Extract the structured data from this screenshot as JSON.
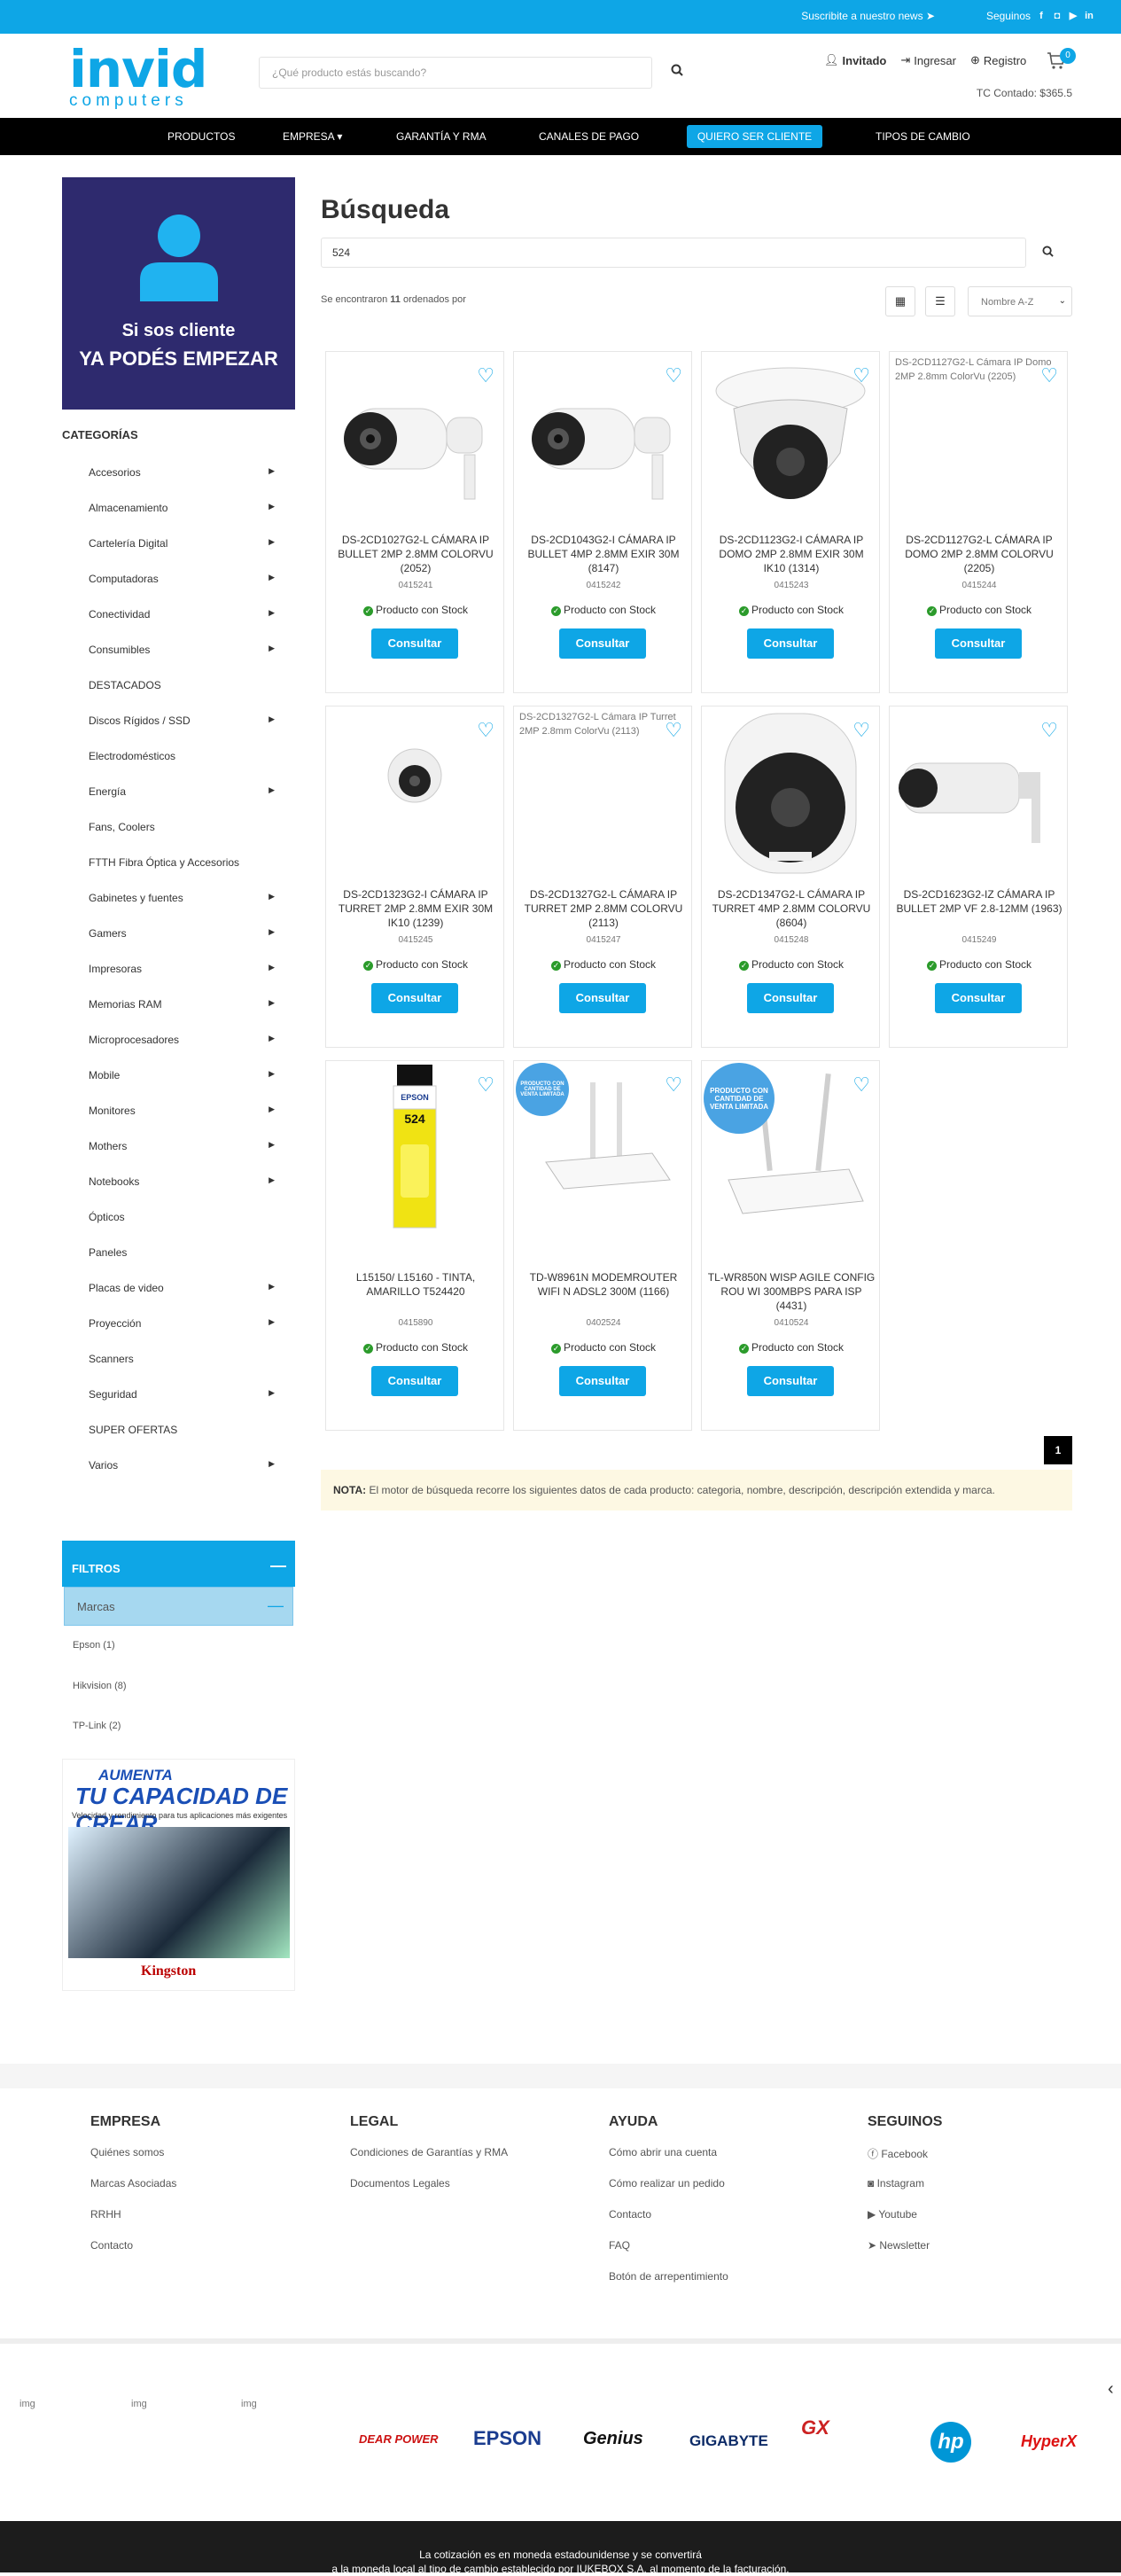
{
  "topbar": {
    "newsletter": "Suscribite a nuestro news",
    "follow": "Seguinos"
  },
  "header": {
    "logo_word": "invid",
    "logo_sub": "computers",
    "search_placeholder": "¿Qué producto estás buscando?",
    "user": "Invitado",
    "login": "Ingresar",
    "register": "Registro",
    "cart_count": "0",
    "tc": "TC Contado: $365.5"
  },
  "nav": [
    "PRODUCTOS",
    "EMPRESA",
    "GARANTÍA Y RMA",
    "CANALES DE PAGO",
    "QUIERO SER CLIENTE",
    "TIPOS DE CAMBIO"
  ],
  "sidebar": {
    "banner_line1": "Si sos cliente",
    "banner_line2": "YA PODÉS EMPEZAR",
    "categories_title": "CATEGORÍAS",
    "categories": [
      "Accesorios",
      "Almacenamiento",
      "Cartelería Digital",
      "Computadoras",
      "Conectividad",
      "Consumibles",
      "DESTACADOS",
      "Discos Rígidos / SSD",
      "Electrodomésticos",
      "Energía",
      "Fans, Coolers",
      "FTTH Fibra Óptica y Accesorios",
      "Gabinetes y fuentes",
      "Gamers",
      "Impresoras",
      "Memorias RAM",
      "Microprocesadores",
      "Mobile",
      "Monitores",
      "Mothers",
      "Notebooks",
      "Ópticos",
      "Paneles",
      "Placas de video",
      "Proyección",
      "Scanners",
      "Seguridad",
      "SUPER OFERTAS",
      "Varios"
    ],
    "filters_title": "FILTROS",
    "marcas_title": "Marcas",
    "brands": [
      "Epson (1)",
      "Hikvision (8)",
      "TP-Link (2)"
    ],
    "kbanner_a": "AUMENTA",
    "kbanner_b": "TU CAPACIDAD DE CREAR",
    "kbanner_c": "Velocidad y rendimiento para tus aplicaciones más exigentes",
    "kbanner_brand": "Kingston"
  },
  "main": {
    "title": "Búsqueda",
    "query": "524",
    "results_pre": "Se encontraron ",
    "results_count": "11",
    "results_post": " ordenados por",
    "sort": "Nombre A-Z",
    "consult": "Consultar",
    "stock": "Producto con Stock",
    "page": "1",
    "note_label": "NOTA:",
    "note": " El motor de búsqueda recorre los siguientes datos de cada producto: categoria, nombre, descripción, descripción extendida y marca."
  },
  "products": [
    {
      "name": "DS-2CD1027G2-L CÁMARA IP BULLET 2MP 2.8MM COLORVU (2052)",
      "code": "0415241"
    },
    {
      "name": "DS-2CD1043G2-I CÁMARA IP BULLET 4MP 2.8MM EXIR 30M (8147)",
      "code": "0415242"
    },
    {
      "name": "DS-2CD1123G2-I CÁMARA IP DOMO 2MP 2.8MM EXIR 30M IK10 (1314)",
      "code": "0415243"
    },
    {
      "name": "DS-2CD1127G2-L CÁMARA IP DOMO 2MP 2.8MM COLORVU (2205)",
      "code": "0415244",
      "alt": "DS-2CD1127G2-L Cámara IP Domo 2MP 2.8mm ColorVu (2205)"
    },
    {
      "name": "DS-2CD1323G2-I CÁMARA IP TURRET 2MP 2.8MM EXIR 30M IK10 (1239)",
      "code": "0415245"
    },
    {
      "name": "DS-2CD1327G2-L CÁMARA IP TURRET 2MP 2.8MM COLORVU (2113)",
      "code": "0415247",
      "alt": "DS-2CD1327G2-L Cámara IP Turret 2MP 2.8mm ColorVu (2113)"
    },
    {
      "name": "DS-2CD1347G2-L CÁMARA IP TURRET 4MP 2.8MM COLORVU (8604)",
      "code": "0415248"
    },
    {
      "name": "DS-2CD1623G2-IZ CÁMARA IP BULLET 2MP VF 2.8-12MM (1963)",
      "code": "0415249"
    },
    {
      "name": "L15150/ L15160 - TINTA, AMARILLO T524420",
      "code": "0415890",
      "label1": "EPSON",
      "label2": "524"
    },
    {
      "name": "TD-W8961N MODEMROUTER WIFI N ADSL2 300M (1166)",
      "code": "0402524",
      "badge": "PRODUCTO CON CANTIDAD DE VENTA LIMITADA"
    },
    {
      "name": "TL-WR850N WISP AGILE CONFIG ROU WI 300MBPS PARA ISP (4431)",
      "code": "0410524",
      "badge": "PRODUCTO CON CANTIDAD DE VENTA LIMITADA"
    }
  ],
  "footer": {
    "cols": [
      {
        "title": "EMPRESA",
        "links": [
          "Quiénes somos",
          "Marcas Asociadas",
          "RRHH",
          "Contacto"
        ]
      },
      {
        "title": "LEGAL",
        "links": [
          "Condiciones de Garantías y RMA",
          "Documentos Legales"
        ]
      },
      {
        "title": "AYUDA",
        "links": [
          "Cómo abrir una cuenta",
          "Cómo realizar un pedido",
          "Contacto",
          "FAQ",
          "Botón de arrepentimiento"
        ]
      },
      {
        "title": "SEGUINOS",
        "links": [
          "Facebook",
          "Instagram",
          "Youtube",
          "Newsletter"
        ]
      }
    ],
    "img_alt": "img",
    "brands": [
      "DEAR POWER",
      "EPSON",
      "Genius",
      "GIGABYTE",
      "GX",
      "hp",
      "HyperX"
    ],
    "bottom1": "La cotización es en moneda estadounidense y se convertirá",
    "bottom2": "a la moneda local al tipo de cambio establecido por IUKEBOX S.A. al momento de la facturación."
  },
  "colors": {
    "accent": "#0ea6e6",
    "nav_bg": "#000000",
    "banner_bg": "#2e2a6e"
  }
}
